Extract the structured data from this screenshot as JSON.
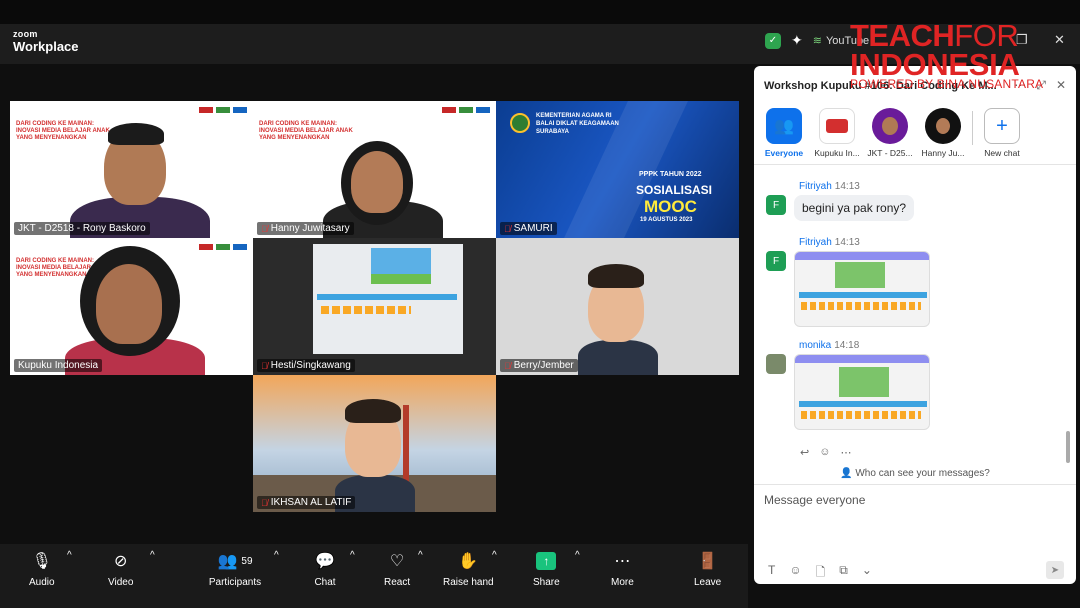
{
  "app": {
    "zoom_small": "zoom",
    "zoom_big": "Workplace"
  },
  "browser": {
    "youtube": "YouTube"
  },
  "watermark": {
    "line1a": "TEACH",
    "line1b": "FOR",
    "line2": "INDONESIA",
    "line3": "POWERED BY BINA NUSANTARA"
  },
  "tiles": [
    {
      "name": "JKT - D2518 - Rony Baskoro",
      "muted": false
    },
    {
      "name": "Hanny Juwitasary",
      "muted": true
    },
    {
      "name": "SAMURI",
      "muted": true
    },
    {
      "name": "Kupuku Indonesia",
      "muted": false
    },
    {
      "name": "Hesti/Singkawang",
      "muted": true
    },
    {
      "name": "Berry/Jember",
      "muted": true
    },
    {
      "name": "IKHSAN AL LATIF",
      "muted": true
    }
  ],
  "banner": {
    "title": "DARI CODING KE MAINAN: INOVASI MEDIA BELAJAR ANAK YANG MENYENANGKAN"
  },
  "mooc": {
    "org": "KEMENTERIAN AGAMA RI\nBALAI DIKLAT KEAGAMAAN\nSURABAYA",
    "line1": "PPPK TAHUN 2022",
    "line2": "SOSIALISASI",
    "line3": "MOOC",
    "line4": "19 AGUSTUS 2023"
  },
  "toolbar": {
    "audio": "Audio",
    "video": "Video",
    "participants": "Participants",
    "participants_count": "59",
    "chat": "Chat",
    "react": "React",
    "raise_hand": "Raise hand",
    "share": "Share",
    "more": "More",
    "leave": "Leave"
  },
  "chat": {
    "title": "Workshop Kupuku #106: Dari Coding Ke M...",
    "recipients": [
      {
        "label": "Everyone"
      },
      {
        "label": "Kupuku In..."
      },
      {
        "label": "JKT - D25..."
      },
      {
        "label": "Hanny Ju..."
      },
      {
        "label": "New chat"
      }
    ],
    "messages": [
      {
        "sender": "Fitriyah",
        "time": "14:13",
        "text": "begini ya pak rony?",
        "avatar": "F"
      },
      {
        "sender": "Fitriyah",
        "time": "14:13",
        "avatar": "F"
      },
      {
        "sender": "monika",
        "time": "14:18"
      }
    ],
    "who_can_see": "Who can see your messages?",
    "input_placeholder": "Message everyone"
  }
}
